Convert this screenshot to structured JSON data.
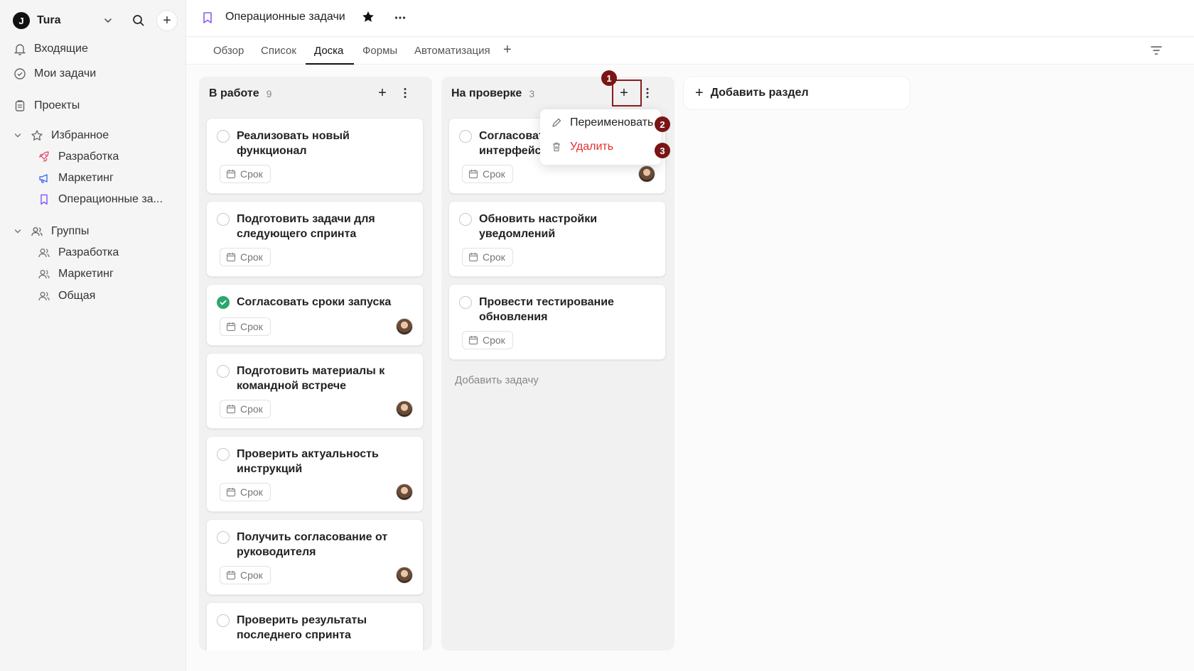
{
  "workspace": {
    "logo": "J",
    "name": "Tura"
  },
  "sidebar": {
    "nav": [
      {
        "label": "Входящие",
        "icon": "bell-icon"
      },
      {
        "label": "Мои задачи",
        "icon": "check-circle-icon"
      },
      {
        "label": "Проекты",
        "icon": "clipboard-icon"
      }
    ],
    "favorites": {
      "label": "Избранное",
      "items": [
        {
          "label": "Разработка",
          "icon": "rocket-icon",
          "color": "#e2557a"
        },
        {
          "label": "Маркетинг",
          "icon": "megaphone-icon",
          "color": "#4a6cf7"
        },
        {
          "label": "Операционные за...",
          "icon": "bookmark-icon",
          "color": "#8b5cf6"
        }
      ]
    },
    "groups": {
      "label": "Группы",
      "items": [
        {
          "label": "Разработка"
        },
        {
          "label": "Маркетинг"
        },
        {
          "label": "Общая"
        }
      ]
    }
  },
  "header": {
    "title": "Операционные задачи",
    "accent": "#8b5cf6"
  },
  "tabs": [
    {
      "label": "Обзор"
    },
    {
      "label": "Список"
    },
    {
      "label": "Доска"
    },
    {
      "label": "Формы"
    },
    {
      "label": "Автоматизация"
    }
  ],
  "active_tab": "Доска",
  "columns": [
    {
      "title": "В работе",
      "count": "9",
      "cards": [
        {
          "title": "Реализовать новый функционал",
          "due": "Срок",
          "done": false,
          "avatar": false
        },
        {
          "title": "Подготовить задачи для следующего спринта",
          "due": "Срок",
          "done": false,
          "avatar": false
        },
        {
          "title": "Согласовать сроки запуска",
          "due": "Срок",
          "done": true,
          "avatar": true
        },
        {
          "title": "Подготовить материалы к командной встрече",
          "due": "Срок",
          "done": false,
          "avatar": true
        },
        {
          "title": "Проверить актуальность инструкций",
          "due": "Срок",
          "done": false,
          "avatar": true
        },
        {
          "title": "Получить согласование от руководителя",
          "due": "Срок",
          "done": false,
          "avatar": true
        },
        {
          "title": "Проверить результаты последнего спринта",
          "due": "Срок",
          "done": false,
          "avatar": false
        }
      ]
    },
    {
      "title": "На проверке",
      "count": "3",
      "cards": [
        {
          "title": "Согласоват интерфейса",
          "due": "Срок",
          "done": false,
          "avatar": true
        },
        {
          "title": "Обновить настройки уведомлений",
          "due": "Срок",
          "done": false,
          "avatar": false
        },
        {
          "title": "Провести тестирование обновления",
          "due": "Срок",
          "done": false,
          "avatar": false
        }
      ],
      "add_task_label": "Добавить задачу"
    }
  ],
  "add_section_label": "Добавить раздел",
  "column_menu": {
    "rename_label": "Переименовать",
    "delete_label": "Удалить",
    "delete_color": "#e0312f"
  },
  "annotations": {
    "badge_1": "1",
    "badge_2": "2",
    "badge_3": "3",
    "color": "#7a1515"
  }
}
